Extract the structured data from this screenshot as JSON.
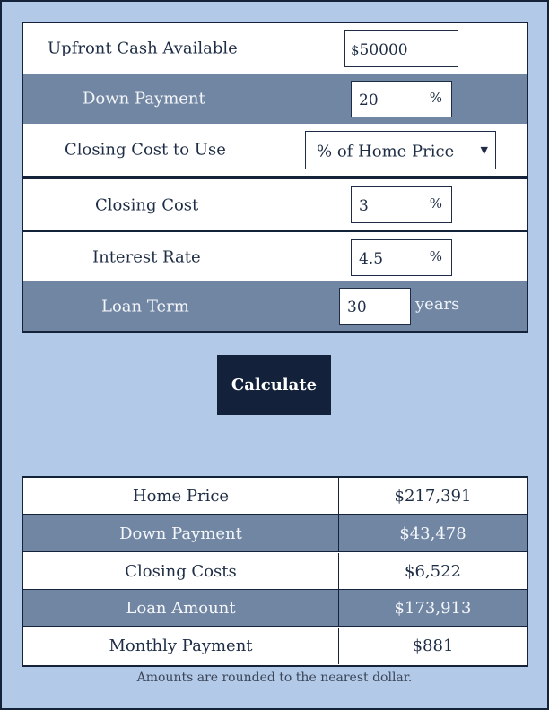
{
  "form": {
    "upfront_cash": {
      "label": "Upfront Cash Available",
      "prefix": "$",
      "value": "50000"
    },
    "down_payment": {
      "label": "Down Payment",
      "value": "20",
      "unit": "%"
    },
    "closing_cost_to_use": {
      "label": "Closing Cost to Use",
      "selected": "% of Home Price",
      "arrow": "▼"
    },
    "closing_cost": {
      "label": "Closing Cost",
      "value": "3",
      "unit": "%"
    },
    "interest_rate": {
      "label": "Interest Rate",
      "value": "4.5",
      "unit": "%"
    },
    "loan_term": {
      "label": "Loan Term",
      "value": "30",
      "unit": "years"
    }
  },
  "calculate_label": "Calculate",
  "results": [
    {
      "label": "Home Price",
      "value": "$217,391"
    },
    {
      "label": "Down Payment",
      "value": "$43,478"
    },
    {
      "label": "Closing Costs",
      "value": "$6,522"
    },
    {
      "label": "Loan Amount",
      "value": "$173,913"
    },
    {
      "label": "Monthly Payment",
      "value": "$881"
    }
  ],
  "footnote": "Amounts are rounded to the nearest dollar.",
  "colors": {
    "background": "#b3c9e8",
    "navy": "#14233a",
    "slate": "#7186a3",
    "button": "#13223a"
  }
}
